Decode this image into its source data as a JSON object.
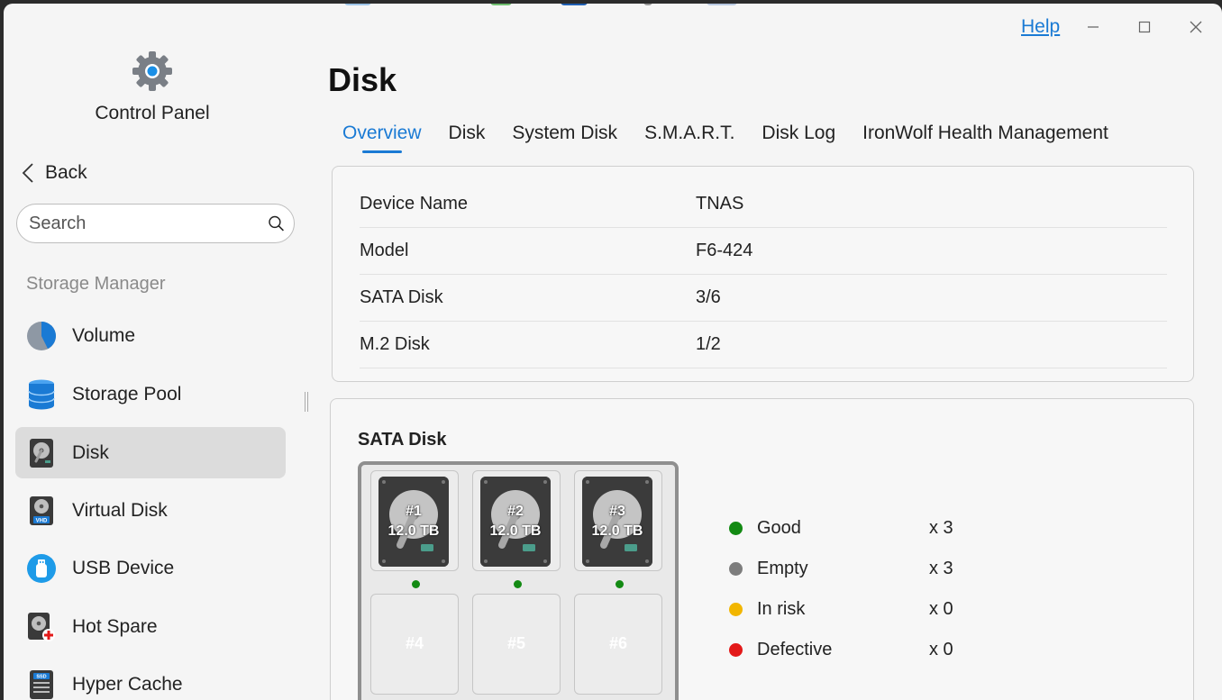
{
  "window": {
    "help_label": "Help",
    "minimize_label": "–",
    "maximize_label": "☐",
    "close_label": "✕"
  },
  "sidebar": {
    "app_title": "Control Panel",
    "back_label": "Back",
    "search_placeholder": "Search",
    "section_label": "Storage Manager",
    "items": [
      {
        "label": "Volume",
        "icon": "pie-chart-icon"
      },
      {
        "label": "Storage Pool",
        "icon": "database-icon"
      },
      {
        "label": "Disk",
        "icon": "hard-disk-icon",
        "active": true
      },
      {
        "label": "Virtual Disk",
        "icon": "vhd-disk-icon"
      },
      {
        "label": "USB Device",
        "icon": "usb-icon"
      },
      {
        "label": "Hot Spare",
        "icon": "hot-spare-disk-icon"
      },
      {
        "label": "Hyper Cache",
        "icon": "ssd-icon"
      }
    ]
  },
  "main": {
    "title": "Disk",
    "tabs": [
      {
        "label": "Overview",
        "active": true
      },
      {
        "label": "Disk"
      },
      {
        "label": "System Disk"
      },
      {
        "label": "S.M.A.R.T."
      },
      {
        "label": "Disk Log"
      },
      {
        "label": "IronWolf Health Management"
      }
    ],
    "info": [
      {
        "key": "Device Name",
        "value": "TNAS"
      },
      {
        "key": "Model",
        "value": "F6-424"
      },
      {
        "key": "SATA Disk",
        "value": "3/6"
      },
      {
        "key": "M.2 Disk",
        "value": "1/2"
      }
    ],
    "sata": {
      "title": "SATA Disk",
      "bays": [
        {
          "num": "#1",
          "capacity": "12.0 TB",
          "status": "good"
        },
        {
          "num": "#2",
          "capacity": "12.0 TB",
          "status": "good"
        },
        {
          "num": "#3",
          "capacity": "12.0 TB",
          "status": "good"
        },
        {
          "num": "#4",
          "status": "empty"
        },
        {
          "num": "#5",
          "status": "empty"
        },
        {
          "num": "#6",
          "status": "empty"
        }
      ],
      "legend": [
        {
          "name": "Good",
          "count": "x 3",
          "color": "#138a13"
        },
        {
          "name": "Empty",
          "count": "x 3",
          "color": "#7d7d7d"
        },
        {
          "name": "In risk",
          "count": "x 0",
          "color": "#f2b600"
        },
        {
          "name": "Defective",
          "count": "x 0",
          "color": "#e31919"
        }
      ]
    }
  },
  "colors": {
    "accent": "#1a7ad4",
    "active_nav_bg": "#dcdcdc"
  }
}
